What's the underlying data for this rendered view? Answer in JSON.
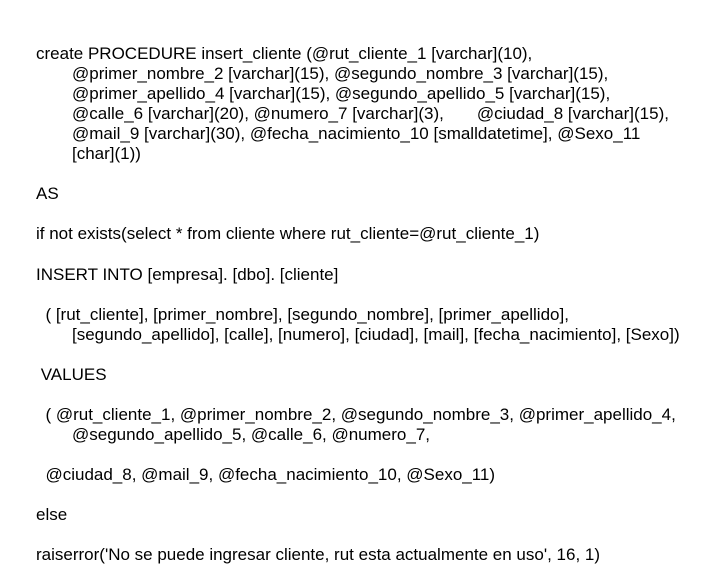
{
  "code": {
    "l1": "create PROCEDURE insert_cliente (@rut_cliente_1 [varchar](10), @primer_nombre_2 [varchar](15), @segundo_nombre_3 [varchar](15),          @primer_apellido_4 [varchar](15), @segundo_apellido_5 [varchar](15), @calle_6 [varchar](20), @numero_7 [varchar](3),       @ciudad_8 [varchar](15), @mail_9 [varchar](30), @fecha_nacimiento_10 [smalldatetime], @Sexo_11 [char](1))",
    "l2": "AS",
    "l3": "if not exists(select * from cliente where rut_cliente=@rut_cliente_1)",
    "l4": "INSERT INTO [empresa]. [dbo]. [cliente]",
    "l5": "  ( [rut_cliente], [primer_nombre], [segundo_nombre], [primer_apellido], [segundo_apellido], [calle], [numero], [ciudad], [mail], [fecha_nacimiento], [Sexo])",
    "l6": " VALUES",
    "l7": "  ( @rut_cliente_1, @primer_nombre_2, @segundo_nombre_3, @primer_apellido_4, @segundo_apellido_5, @calle_6, @numero_7,",
    "l8": "  @ciudad_8, @mail_9, @fecha_nacimiento_10, @Sexo_11)",
    "l9": "else",
    "l10": "raiserror('No se puede ingresar cliente, rut esta actualmente en uso', 16, 1)"
  }
}
